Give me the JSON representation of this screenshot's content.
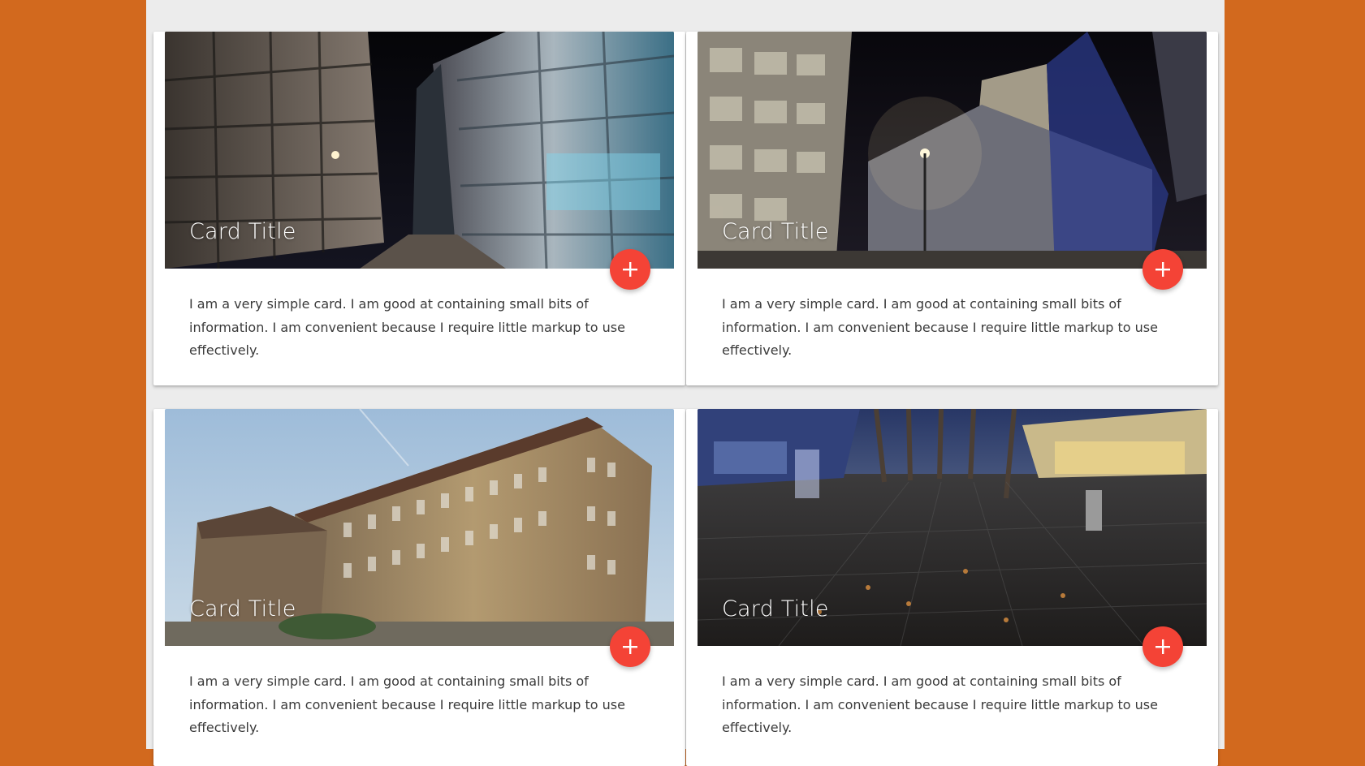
{
  "cards": [
    {
      "title": "Card Title",
      "text": "I am a very simple card. I am good at containing small bits of information. I am convenient because I require little markup to use effectively.",
      "image_description": "night city street with modern office buildings",
      "fab_icon": "plus-icon"
    },
    {
      "title": "Card Title",
      "text": "I am a very simple card. I am good at containing small bits of information. I am convenient because I require little markup to use effectively.",
      "image_description": "night city square with hotel tower and street lamp",
      "fab_icon": "plus-icon"
    },
    {
      "title": "Card Title",
      "text": "I am a very simple card. I am good at containing small bits of information. I am convenient because I require little markup to use effectively.",
      "image_description": "large historic sandstone building under blue sky",
      "fab_icon": "plus-icon"
    },
    {
      "title": "Card Title",
      "text": "I am a very simple card. I am good at containing small bits of information. I am convenient because I require little markup to use effectively.",
      "image_description": "night pedestrian shopping street with wet tiles",
      "fab_icon": "plus-icon"
    }
  ],
  "colors": {
    "background": "#d2691e",
    "page": "#ececec",
    "fab": "#f44336",
    "text": "#3a3a3a"
  }
}
